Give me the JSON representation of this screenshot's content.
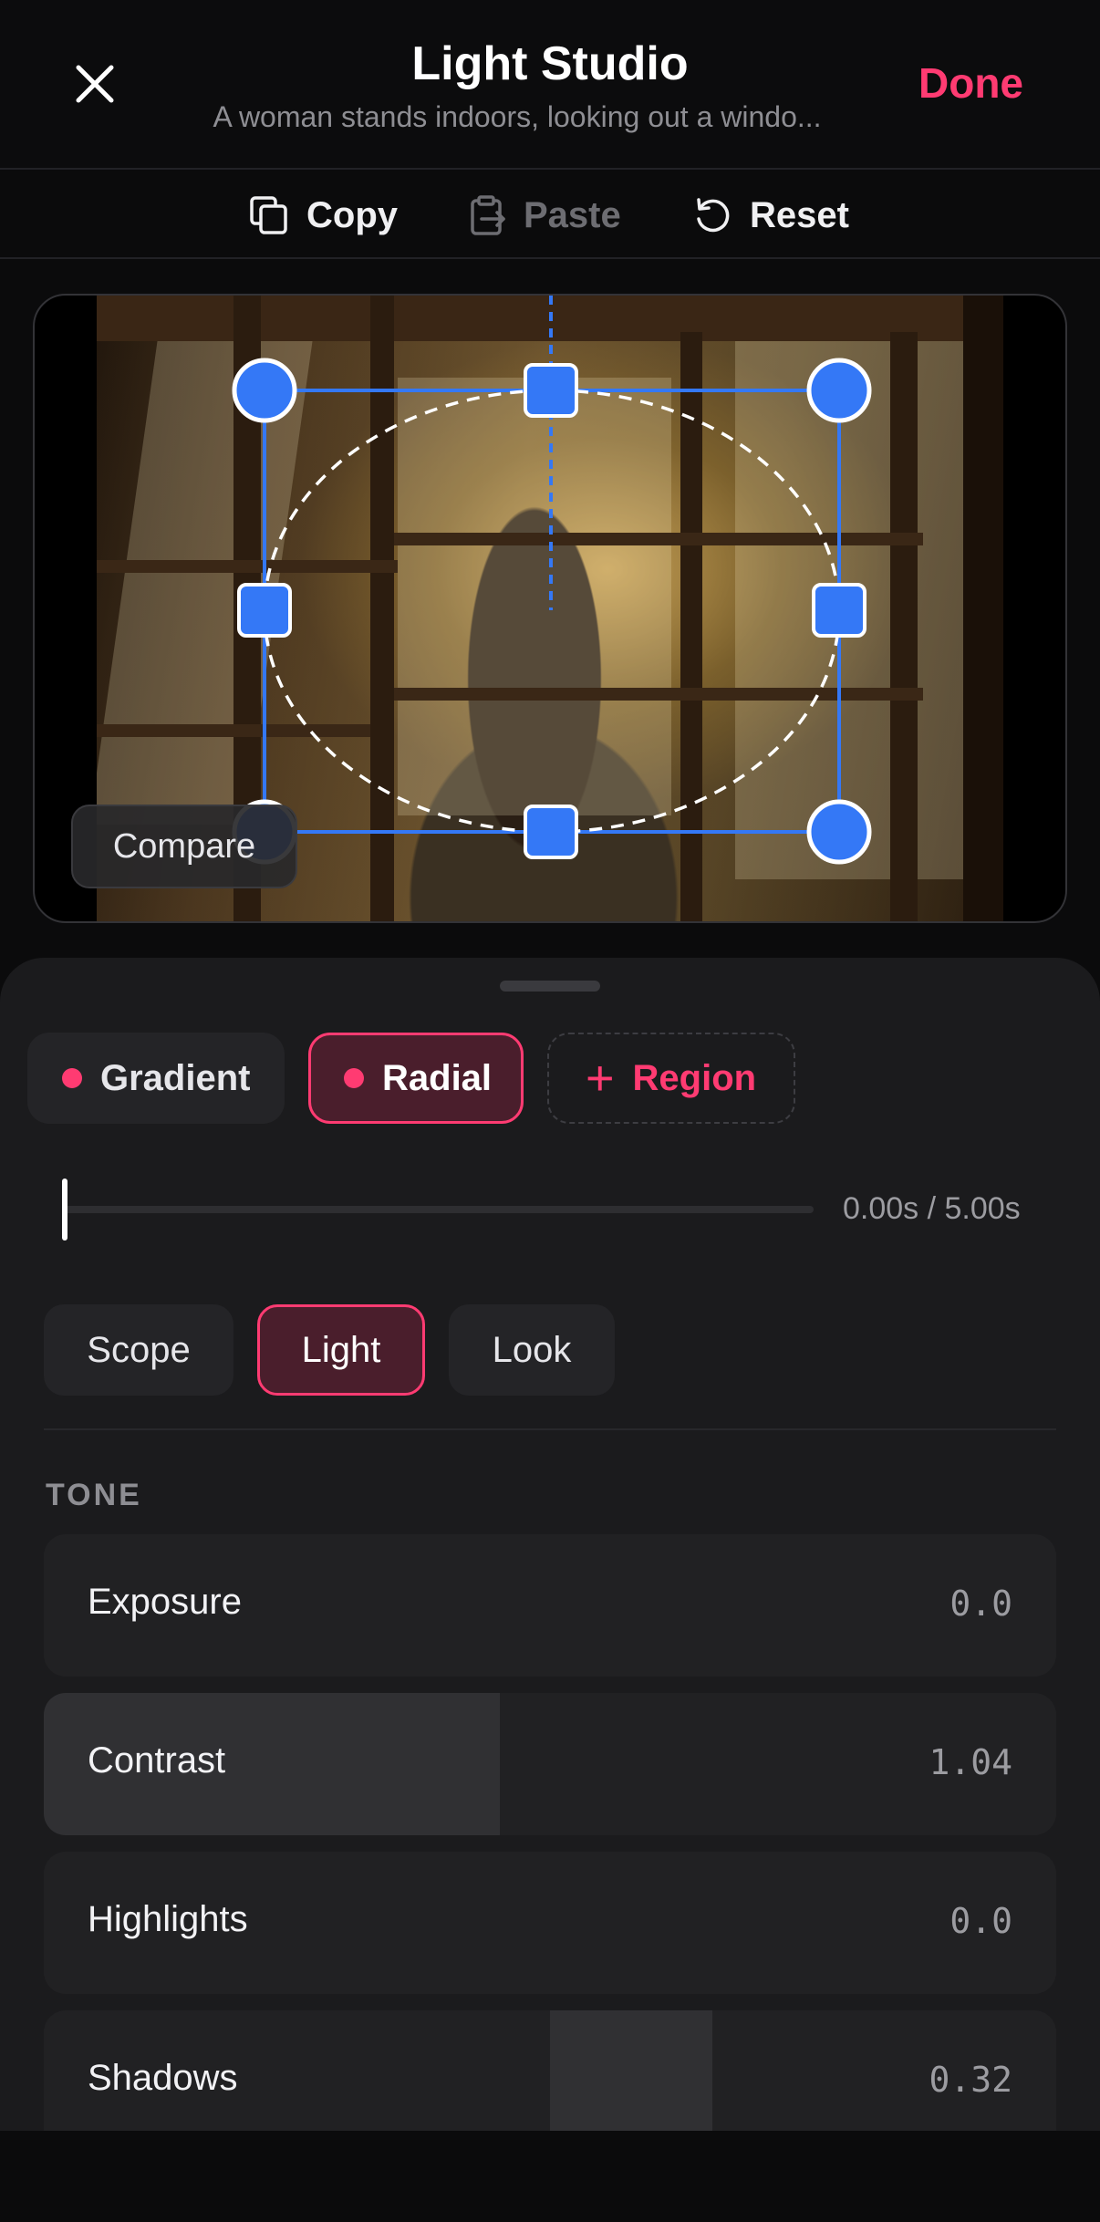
{
  "header": {
    "close_icon": "close-x-icon",
    "title": "Light Studio",
    "subtitle": "A woman stands indoors, looking out a windo...",
    "done_label": "Done"
  },
  "toolbar": {
    "copy": {
      "label": "Copy",
      "icon": "copy-icon"
    },
    "paste": {
      "label": "Paste",
      "icon": "clipboard-paste-icon",
      "disabled": true
    },
    "reset": {
      "label": "Reset",
      "icon": "reset-arrow-icon"
    }
  },
  "preview": {
    "compare_label": "Compare"
  },
  "masks": {
    "items": [
      {
        "label": "Gradient",
        "selected": false
      },
      {
        "label": "Radial",
        "selected": true
      }
    ],
    "add_label": "Region"
  },
  "timeline": {
    "time_text": "0.00s / 5.00s",
    "position": 0
  },
  "tabs": [
    {
      "label": "Scope",
      "selected": false
    },
    {
      "label": "Light",
      "selected": true
    },
    {
      "label": "Look",
      "selected": false
    }
  ],
  "tone": {
    "section_label": "TONE",
    "sliders": [
      {
        "label": "Exposure",
        "value": "0.0"
      },
      {
        "label": "Contrast",
        "value": "1.04"
      },
      {
        "label": "Highlights",
        "value": "0.0"
      },
      {
        "label": "Shadows",
        "value": "0.32"
      }
    ]
  },
  "colors": {
    "accent": "#ff3b72",
    "handle_blue": "#3478f6",
    "background": "#0b0b0c",
    "panel": "#1b1b1d"
  }
}
